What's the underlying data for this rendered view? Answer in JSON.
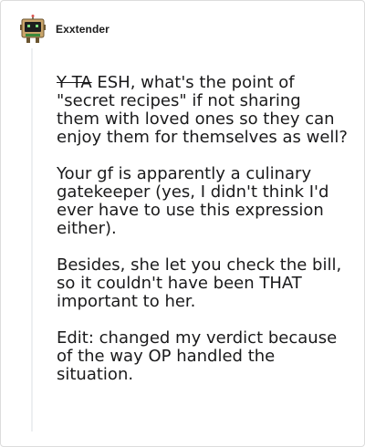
{
  "comment": {
    "username": "Exxtender",
    "avatar_icon": "robot-avatar-icon",
    "paragraphs": [
      {
        "struck": "Y TA",
        "text": " ESH, what's the point of \"secret recipes\" if not sharing them with loved ones so they can enjoy them for themselves as well?"
      },
      {
        "text": "Your gf is apparently a culinary gatekeeper (yes, I didn't think I'd ever have to use this expression either)."
      },
      {
        "text": "Besides, she let you check the bill, so it couldn't have been THAT important to her."
      },
      {
        "text": "Edit: changed my verdict because of the way OP handled the situation."
      }
    ]
  },
  "colors": {
    "text": "#1a1a1b",
    "border": "#dcdcdc",
    "thread_line": "#edeff1",
    "avatar_body": "#c9a46a",
    "avatar_screen": "#1e1e1e",
    "avatar_accent": "#3c8a3c"
  }
}
